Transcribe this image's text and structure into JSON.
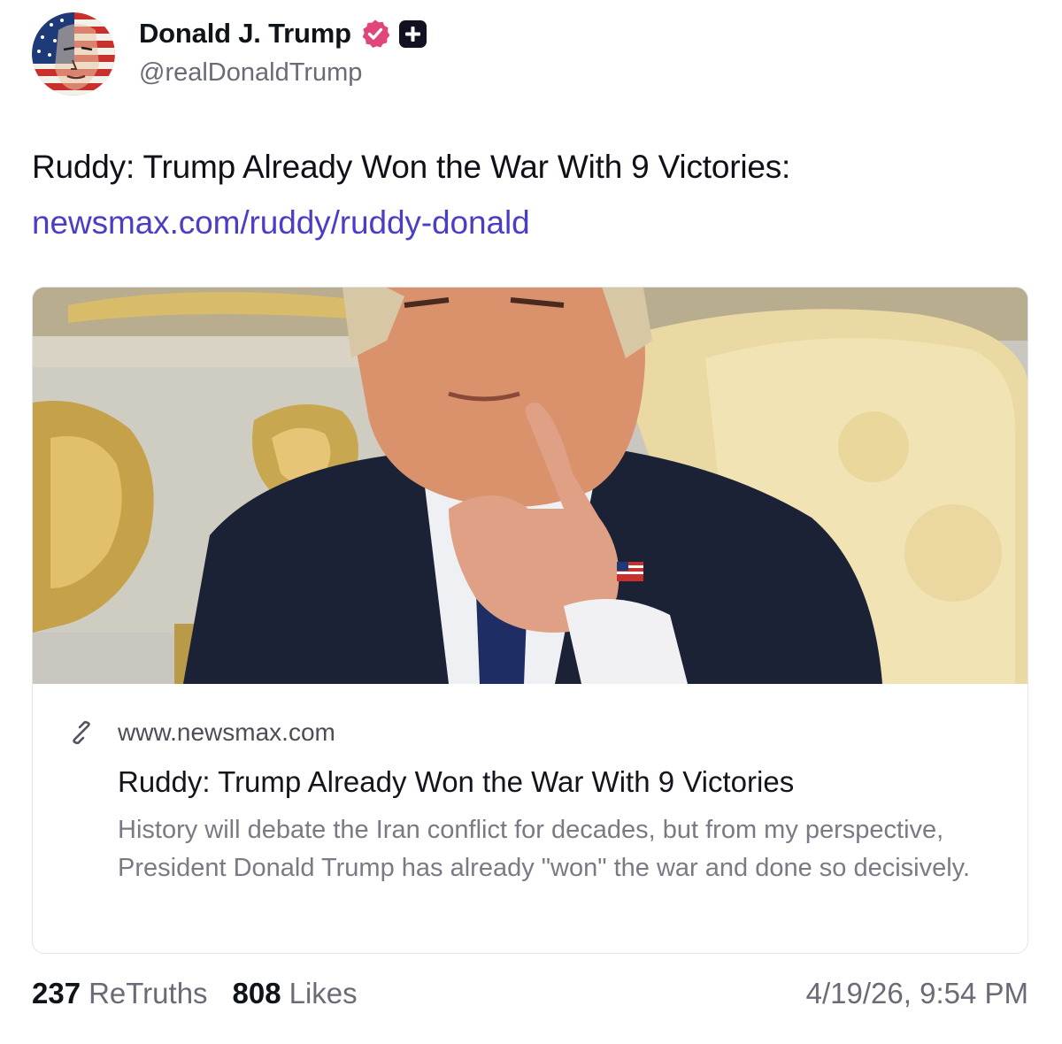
{
  "author": {
    "display_name": "Donald J. Trump",
    "handle": "@realDonaldTrump",
    "avatar_icon": "flag-face-avatar",
    "verified_icon": "verified-badge-icon",
    "verified_color": "#e0457b",
    "plus_icon": "truth-plus-badge-icon"
  },
  "post": {
    "text": "Ruddy: Trump Already Won the War With 9 Victories:",
    "link_text": "newsmax.com/ruddy/ruddy-donald",
    "link_color": "#4a3ec6"
  },
  "card": {
    "image": "pointing-man-photo",
    "domain_icon": "link-icon",
    "domain": "www.newsmax.com",
    "title": "Ruddy: Trump Already Won the War With 9 Victories",
    "description": "History will debate the Iran conflict for decades, but from my perspective, President Donald Trump has already \"won\" the war and done so decisively."
  },
  "stats": {
    "retruths_count": "237",
    "retruths_label": "ReTruths",
    "likes_count": "808",
    "likes_label": "Likes"
  },
  "timestamp": "4/19/26, 9:54 PM"
}
